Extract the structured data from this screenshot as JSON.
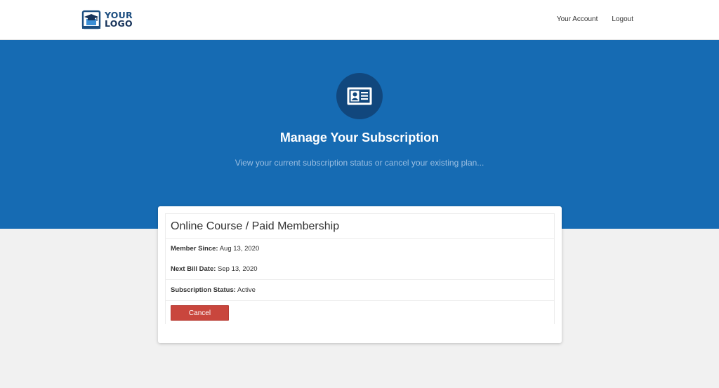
{
  "header": {
    "logo_line1": "YOUR",
    "logo_line2": "LOGO",
    "nav": {
      "account_label": "Your Account",
      "logout_label": "Logout"
    }
  },
  "hero": {
    "icon": "id-card-icon",
    "title": "Manage Your Subscription",
    "subtitle": "View your current subscription status or cancel your existing plan..."
  },
  "subscription": {
    "title": "Online Course / Paid Membership",
    "member_since_label": "Member Since:",
    "member_since_value": "Aug 13, 2020",
    "next_bill_label": "Next Bill Date:",
    "next_bill_value": "Sep 13, 2020",
    "status_label": "Subscription Status:",
    "status_value": "Active",
    "cancel_label": "Cancel"
  },
  "colors": {
    "hero_bg": "#166bb3",
    "icon_circle": "#11477d",
    "cancel_button": "#c9463d",
    "logo_blue": "#1c4e80"
  }
}
